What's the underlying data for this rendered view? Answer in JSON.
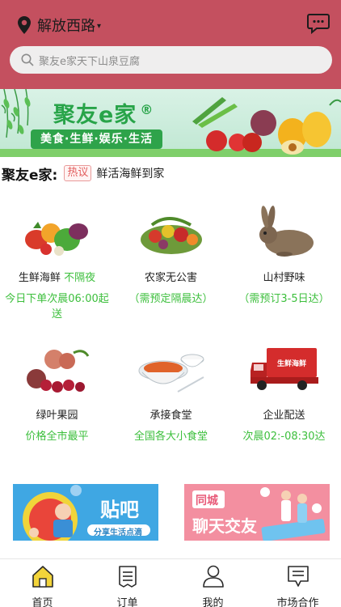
{
  "header": {
    "location": "解放西路",
    "search_placeholder": "聚友e家天下山泉豆腐"
  },
  "banner": {
    "title": "聚友e家",
    "registered_mark": "®",
    "tags": "美食·生鲜·娱乐·生活"
  },
  "notice": {
    "brand": "聚友e家:",
    "badge": "热议",
    "text": "鲜活海鲜到家"
  },
  "categories": [
    {
      "name": "生鲜海鲜",
      "name_extra": "不隔夜",
      "subtitle": "今日下单次晨06:00起送",
      "icon": "vegetables-icon"
    },
    {
      "name": "农家无公害",
      "name_extra": "",
      "subtitle": "（需预定隔晨达）",
      "icon": "farm-produce-icon"
    },
    {
      "name": "山村野味",
      "name_extra": "",
      "subtitle": "（需预订3-5日达）",
      "icon": "rabbit-icon"
    },
    {
      "name": "绿叶果园",
      "name_extra": "",
      "subtitle": "价格全市最平",
      "icon": "fruit-icon"
    },
    {
      "name": "承接食堂",
      "name_extra": "",
      "subtitle": "全国各大小食堂",
      "icon": "meal-bowl-icon"
    },
    {
      "name": "企业配送",
      "name_extra": "",
      "subtitle": "次晨02:-08:30达",
      "icon": "delivery-truck-icon",
      "truck_text": "生鲜海鲜"
    }
  ],
  "promos": {
    "left": {
      "title": "贴吧",
      "subtitle": "分享生活点滴"
    },
    "right": {
      "badge": "同城",
      "title": "聊天交友"
    }
  },
  "tabs": [
    {
      "label": "首页",
      "icon": "home-icon"
    },
    {
      "label": "订单",
      "icon": "order-icon"
    },
    {
      "label": "我的",
      "icon": "user-icon"
    },
    {
      "label": "市场合作",
      "icon": "cooperation-icon"
    }
  ],
  "colors": {
    "header_bg": "#c4505f",
    "accent_green": "#3cbf3c",
    "banner_green": "#28a449"
  }
}
